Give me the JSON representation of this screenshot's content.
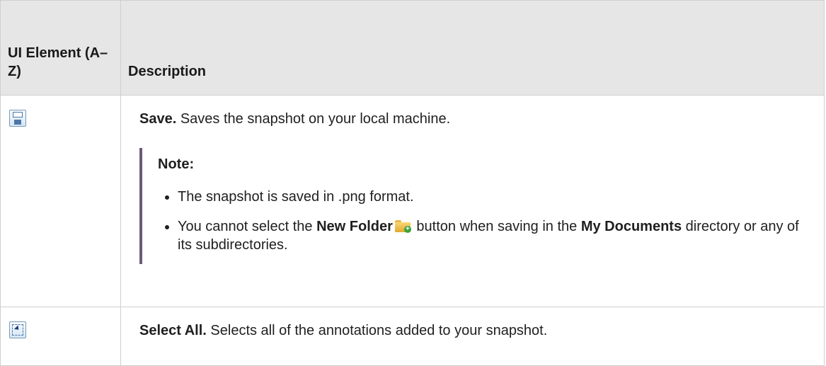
{
  "table": {
    "headers": [
      "UI Element (A–Z)",
      "Description"
    ],
    "rows": [
      {
        "icon": "save-floppy-icon",
        "title": "Save.",
        "text": " Saves the snapshot on your local machine.",
        "note": {
          "title": "Note:",
          "items": [
            "The snapshot is saved in .png format.",
            {
              "pre": "You cannot select the ",
              "bold1": "New Folder",
              "icon": "new-folder-icon",
              "mid": " button when saving in the ",
              "bold2": "My Documents",
              "post": " directory or any of its subdirectories."
            }
          ]
        }
      },
      {
        "icon": "select-all-icon",
        "title": "Select All.",
        "text": " Selects all of the annotations added to your snapshot."
      }
    ]
  }
}
